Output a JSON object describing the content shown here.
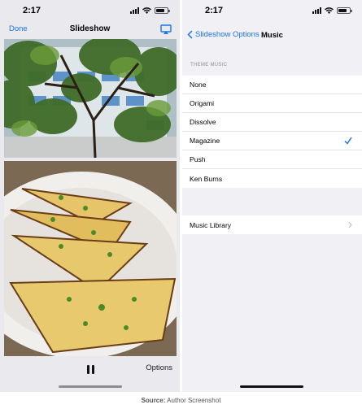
{
  "left": {
    "time": "2:17",
    "done": "Done",
    "title": "Slideshow",
    "options": "Options"
  },
  "right": {
    "time": "2:17",
    "back": "Slideshow Options",
    "title": "Music",
    "section": "THEME MUSIC",
    "themes": [
      "None",
      "Origami",
      "Dissolve",
      "Magazine",
      "Push",
      "Ken Burns"
    ],
    "selected": "Magazine",
    "library": "Music Library"
  },
  "source": {
    "label": "Source:",
    "text": "Author Screenshot"
  },
  "colors": {
    "accent": "#1a73e8"
  }
}
